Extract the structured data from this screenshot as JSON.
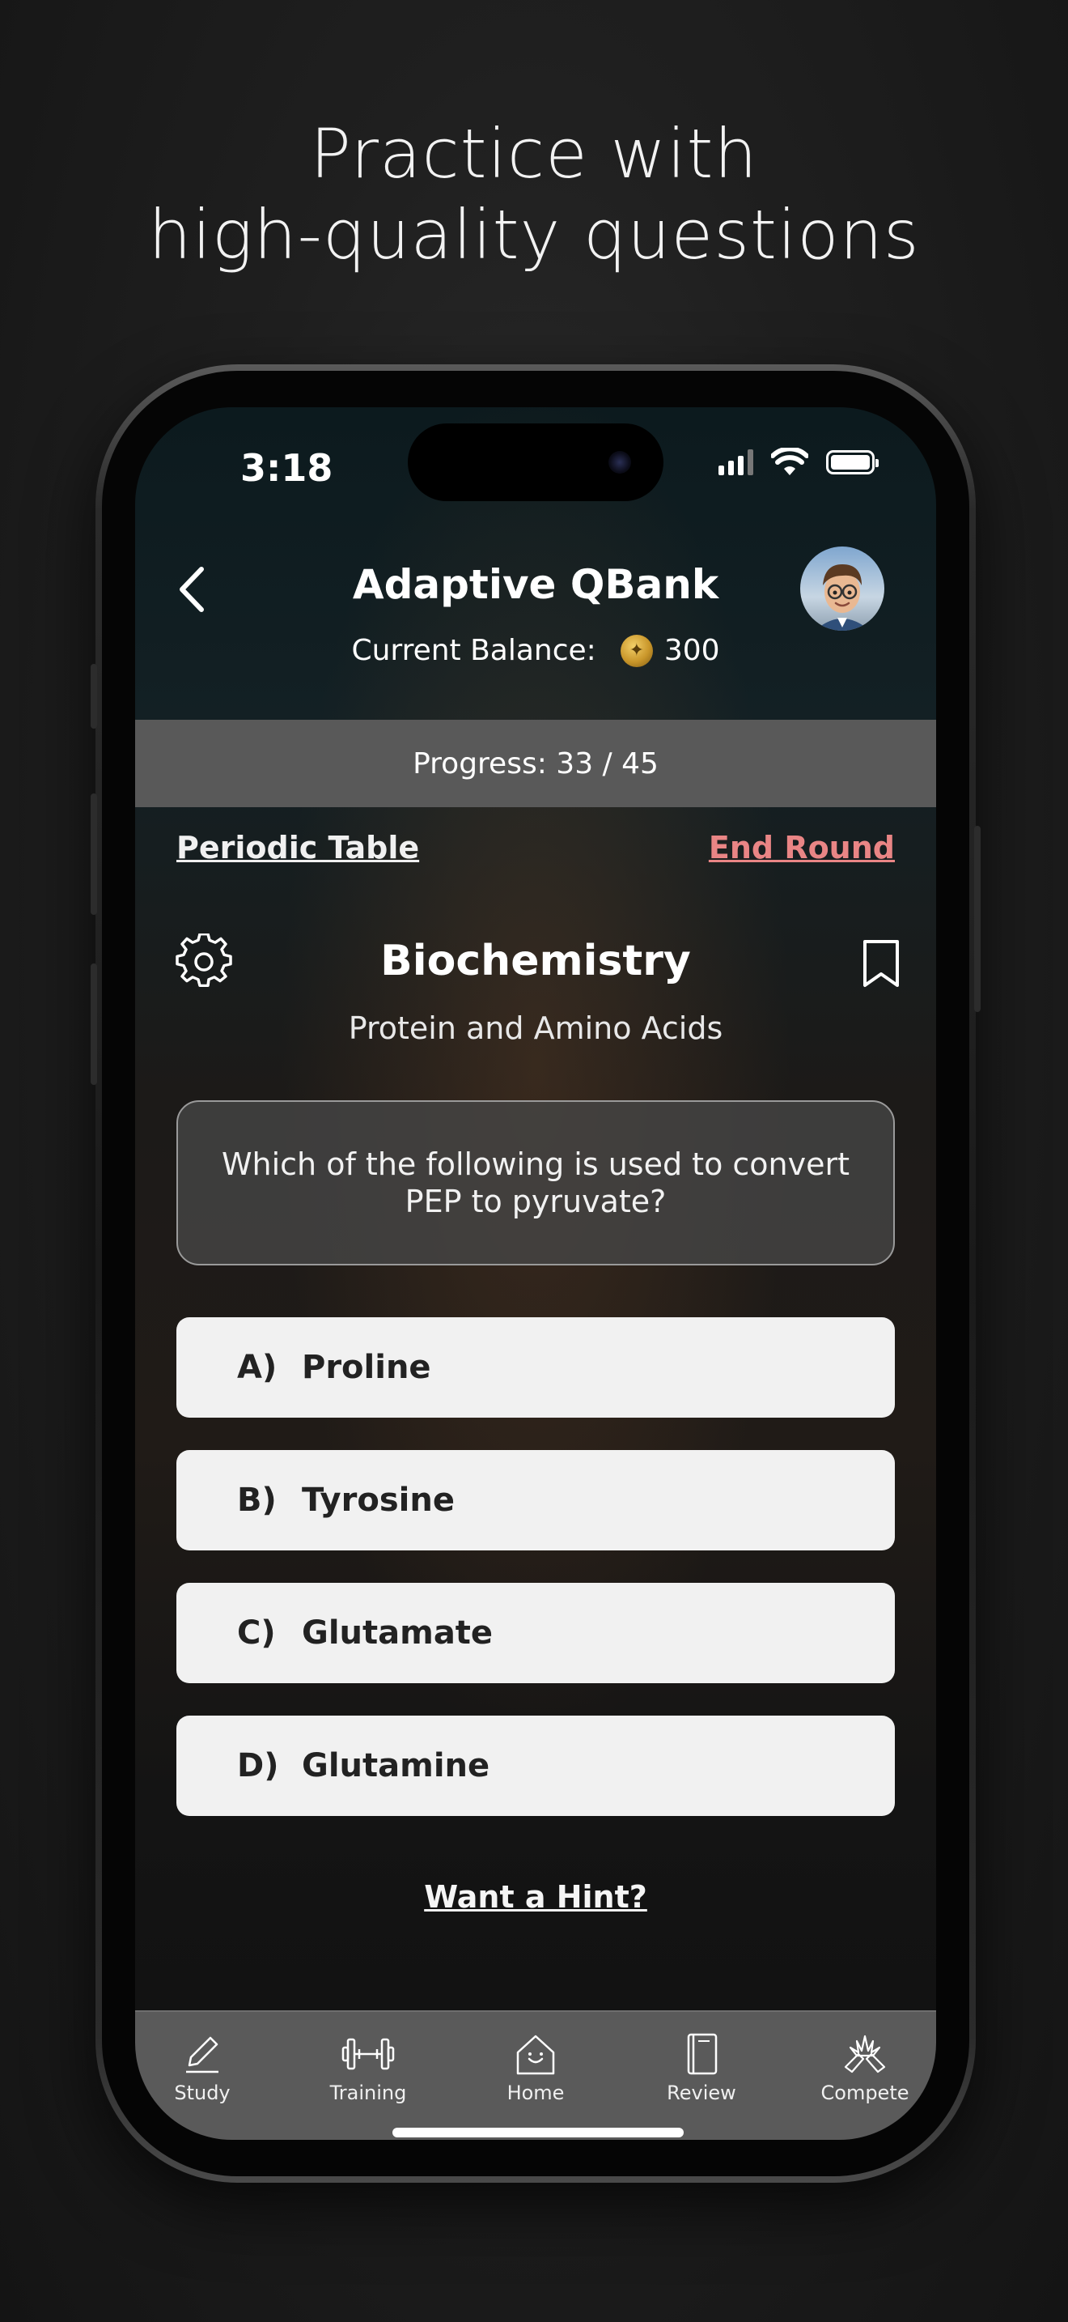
{
  "promo": {
    "line1": "Practice with",
    "line2": "high-quality questions"
  },
  "status_bar": {
    "time": "3:18",
    "icons": [
      "signal-icon",
      "wifi-icon",
      "battery-icon"
    ]
  },
  "header": {
    "title": "Adaptive QBank",
    "balance_label": "Current Balance:",
    "balance_value": "300",
    "back_icon": "chevron-left-icon",
    "avatar": "user-avatar"
  },
  "progress": {
    "label": "Progress: 33 / 45",
    "current": 33,
    "total": 45
  },
  "links": {
    "periodic_table": "Periodic Table",
    "end_round": "End Round"
  },
  "question": {
    "subject": "Biochemistry",
    "topic": "Protein and Amino Acids",
    "text": "Which of the following is used to convert PEP to pyruvate?"
  },
  "answers": [
    {
      "letter": "A)",
      "text": "Proline"
    },
    {
      "letter": "B)",
      "text": "Tyrosine"
    },
    {
      "letter": "C)",
      "text": "Glutamate"
    },
    {
      "letter": "D)",
      "text": "Glutamine"
    }
  ],
  "hint_label": "Want a Hint?",
  "tabs": [
    {
      "label": "Study",
      "icon": "pencil-icon"
    },
    {
      "label": "Training",
      "icon": "dumbbell-icon"
    },
    {
      "label": "Home",
      "icon": "home-icon"
    },
    {
      "label": "Review",
      "icon": "book-icon"
    },
    {
      "label": "Compete",
      "icon": "compete-icon"
    }
  ],
  "colors": {
    "end_round": "#e98585",
    "progress_bg": "#595959",
    "answer_bg": "#f1f1f1",
    "tabbar_bg": "#5a5a5a"
  }
}
